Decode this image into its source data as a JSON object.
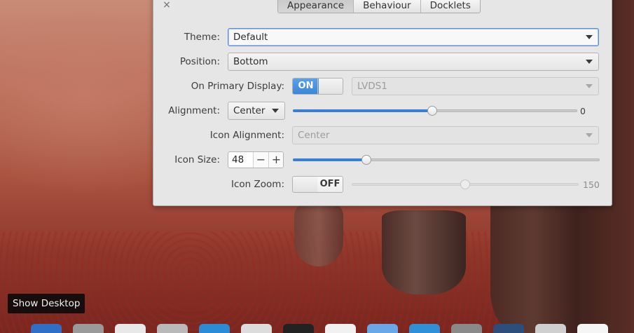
{
  "window": {
    "close_glyph": "×",
    "tabs": [
      {
        "label": "Appearance",
        "active": true
      },
      {
        "label": "Behaviour",
        "active": false
      },
      {
        "label": "Docklets",
        "active": false
      }
    ]
  },
  "settings": {
    "theme": {
      "label": "Theme:",
      "value": "Default"
    },
    "position": {
      "label": "Position:",
      "value": "Bottom"
    },
    "primary_display": {
      "label": "On Primary Display:",
      "switch_label": "ON",
      "monitor": "LVDS1"
    },
    "alignment": {
      "label": "Alignment:",
      "value": "Center",
      "offset_value": "0",
      "offset_fraction": 0.49
    },
    "icon_alignment": {
      "label": "Icon Alignment:",
      "value": "Center"
    },
    "icon_size": {
      "label": "Icon Size:",
      "value": "48",
      "minus": "−",
      "plus": "+",
      "fraction": 0.24
    },
    "icon_zoom": {
      "label": "Icon Zoom:",
      "switch_label": "OFF",
      "value": "150",
      "fraction": 0.5
    }
  },
  "tooltip": {
    "text": "Show Desktop"
  },
  "colors": {
    "accent": "#3b7fd2",
    "window_bg": "#e6e6e6",
    "tooltip_bg": "#0a0a0a"
  },
  "dock": {
    "icons": [
      "files-icon",
      "scissors-icon",
      "clock-icon",
      "trash-icon",
      "browser-icon",
      "drive-icon",
      "clapper-icon",
      "document-icon",
      "finder-icon",
      "globe-icon",
      "settings-icon",
      "box-icon",
      "printer-icon",
      "calendar-icon"
    ]
  }
}
